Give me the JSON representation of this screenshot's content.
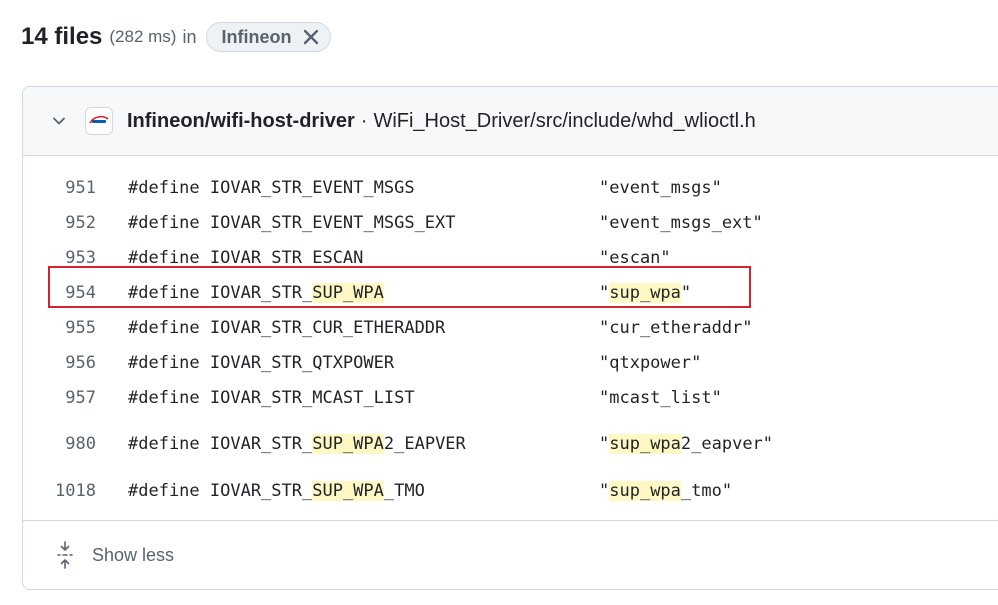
{
  "summary": {
    "count": "14 files",
    "timing": "(282 ms)",
    "in_word": "in",
    "filter_chip": "Infineon"
  },
  "result": {
    "repo": "Infineon/wifi-host-driver",
    "separator": "·",
    "path": "WiFi_Host_Driver/src/include/whd_wlioctl.h",
    "lines": [
      {
        "num": "951",
        "define_parts": [
          {
            "t": "#define IOVAR_STR_EVENT_MSGS",
            "hl": false
          }
        ],
        "value_parts": [
          {
            "t": "\"event_msgs\"",
            "hl": false
          }
        ]
      },
      {
        "num": "952",
        "define_parts": [
          {
            "t": "#define IOVAR_STR_EVENT_MSGS_EXT",
            "hl": false
          }
        ],
        "value_parts": [
          {
            "t": "\"event_msgs_ext\"",
            "hl": false
          }
        ]
      },
      {
        "num": "953",
        "define_parts": [
          {
            "t": "#define IOVAR_STR_ESCAN",
            "hl": false
          }
        ],
        "value_parts": [
          {
            "t": "\"escan\"",
            "hl": false
          }
        ]
      },
      {
        "num": "954",
        "define_parts": [
          {
            "t": "#define IOVAR_STR_",
            "hl": false
          },
          {
            "t": "SUP_WPA",
            "hl": true
          }
        ],
        "value_parts": [
          {
            "t": "\"",
            "hl": false
          },
          {
            "t": "sup_wpa",
            "hl": true
          },
          {
            "t": "\"",
            "hl": false
          }
        ]
      },
      {
        "num": "955",
        "define_parts": [
          {
            "t": "#define IOVAR_STR_CUR_ETHERADDR",
            "hl": false
          }
        ],
        "value_parts": [
          {
            "t": "\"cur_etheraddr\"",
            "hl": false
          }
        ]
      },
      {
        "num": "956",
        "define_parts": [
          {
            "t": "#define IOVAR_STR_QTXPOWER",
            "hl": false
          }
        ],
        "value_parts": [
          {
            "t": "\"qtxpower\"",
            "hl": false
          }
        ]
      },
      {
        "num": "957",
        "define_parts": [
          {
            "t": "#define IOVAR_STR_MCAST_LIST",
            "hl": false
          }
        ],
        "value_parts": [
          {
            "t": "\"mcast_list\"",
            "hl": false
          }
        ]
      },
      {
        "num": "980",
        "define_parts": [
          {
            "t": "#define IOVAR_STR_",
            "hl": false
          },
          {
            "t": "SUP_WPA",
            "hl": true
          },
          {
            "t": "2_EAPVER",
            "hl": false
          }
        ],
        "value_parts": [
          {
            "t": "\"",
            "hl": false
          },
          {
            "t": "sup_wpa",
            "hl": true
          },
          {
            "t": "2_eapver\"",
            "hl": false
          }
        ]
      },
      {
        "num": "1018",
        "define_parts": [
          {
            "t": "#define IOVAR_STR_",
            "hl": false
          },
          {
            "t": "SUP_WPA",
            "hl": true
          },
          {
            "t": "_TMO",
            "hl": false
          }
        ],
        "value_parts": [
          {
            "t": "\"",
            "hl": false
          },
          {
            "t": "sup_wpa",
            "hl": true
          },
          {
            "t": "_tmo\"",
            "hl": false
          }
        ]
      }
    ],
    "footer_label": "Show less"
  },
  "colors": {
    "match_highlight": "#fff8c5",
    "annotation_box": "#d1242f"
  },
  "icons": {
    "chevron": "chevron-down-icon",
    "chip_close": "x-icon",
    "footer": "fold-icon",
    "avatar": "infineon-logo"
  }
}
